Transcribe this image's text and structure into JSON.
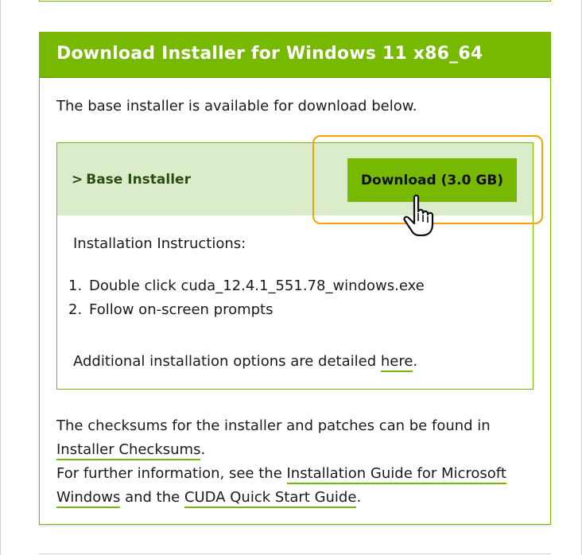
{
  "card": {
    "title": "Download Installer for Windows 11 x86_64",
    "intro": "The base installer is available for download below."
  },
  "installer": {
    "label": "Base Installer",
    "chevron_icon": "chevron-right-icon",
    "download_label": "Download (3.0 GB)",
    "instructions_title": "Installation Instructions:",
    "steps": [
      {
        "num": "1.",
        "text": "Double click cuda_12.4.1_551.78_windows.exe"
      },
      {
        "num": "2.",
        "text": "Follow on-screen prompts"
      }
    ],
    "additional_prefix": "Additional installation options are detailed ",
    "additional_link": "here",
    "additional_suffix": "."
  },
  "footer": {
    "checksum_text": "The checksums for the installer and patches can be found in ",
    "checksum_link": "Installer Checksums",
    "checksum_suffix": ".",
    "info_prefix": "For further information, see the ",
    "guide_link": "Installation Guide for Microsoft Windows",
    "info_mid": " and the ",
    "quickstart_link": "CUDA Quick Start Guide",
    "info_suffix": "."
  },
  "colors": {
    "accent": "#76b900",
    "header_bg_light": "#dbeccb",
    "highlight": "#f2a300"
  },
  "cursor_icon": "hand-pointer-icon"
}
